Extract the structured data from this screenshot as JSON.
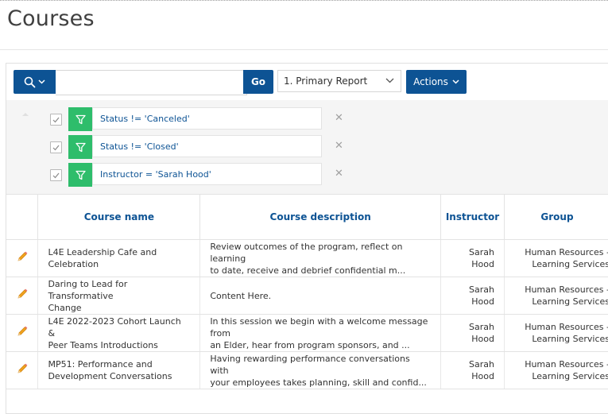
{
  "page": {
    "title": "Courses"
  },
  "toolbar": {
    "search_value": "",
    "go_label": "Go",
    "report_selected": "1. Primary Report",
    "actions_label": "Actions"
  },
  "filters": [
    {
      "label": "Status != 'Canceled'",
      "checked": true
    },
    {
      "label": "Status != 'Closed'",
      "checked": true
    },
    {
      "label": "Instructor = 'Sarah Hood'",
      "checked": true
    }
  ],
  "table": {
    "columns": [
      "Course name",
      "Course description",
      "Instructor",
      "Group"
    ],
    "rows": [
      {
        "name_l1": "L4E Leadership Cafe and",
        "name_l2": "Celebration",
        "desc_l1": "Review outcomes of the program, reflect on learning",
        "desc_l2": "to date, receive and debrief confidential m...",
        "instr_l1": "Sarah",
        "instr_l2": "Hood",
        "group_l1": "Human Resources -",
        "group_l2": "Learning Services"
      },
      {
        "name_l1": "Daring to Lead for Transformative",
        "name_l2": "Change",
        "desc_l1": "Content Here.",
        "desc_l2": "",
        "instr_l1": "Sarah",
        "instr_l2": "Hood",
        "group_l1": "Human Resources -",
        "group_l2": "Learning Services"
      },
      {
        "name_l1": "L4E 2022-2023 Cohort Launch &",
        "name_l2": "Peer Teams Introductions",
        "desc_l1": "In this session we begin with a welcome message from",
        "desc_l2": "an Elder, hear from program sponsors, and ...",
        "instr_l1": "Sarah",
        "instr_l2": "Hood",
        "group_l1": "Human Resources -",
        "group_l2": "Learning Services"
      },
      {
        "name_l1": "MP51: Performance and",
        "name_l2": "Development Conversations",
        "desc_l1": "Having rewarding performance conversations with",
        "desc_l2": "your employees takes planning, skill and confid...",
        "instr_l1": "Sarah",
        "instr_l2": "Hood",
        "group_l1": "Human Resources -",
        "group_l2": "Learning Services"
      }
    ]
  },
  "colors": {
    "primary": "#0d5394",
    "filter_green": "#2ebd6b",
    "edit_pencil": "#f0a21e"
  }
}
